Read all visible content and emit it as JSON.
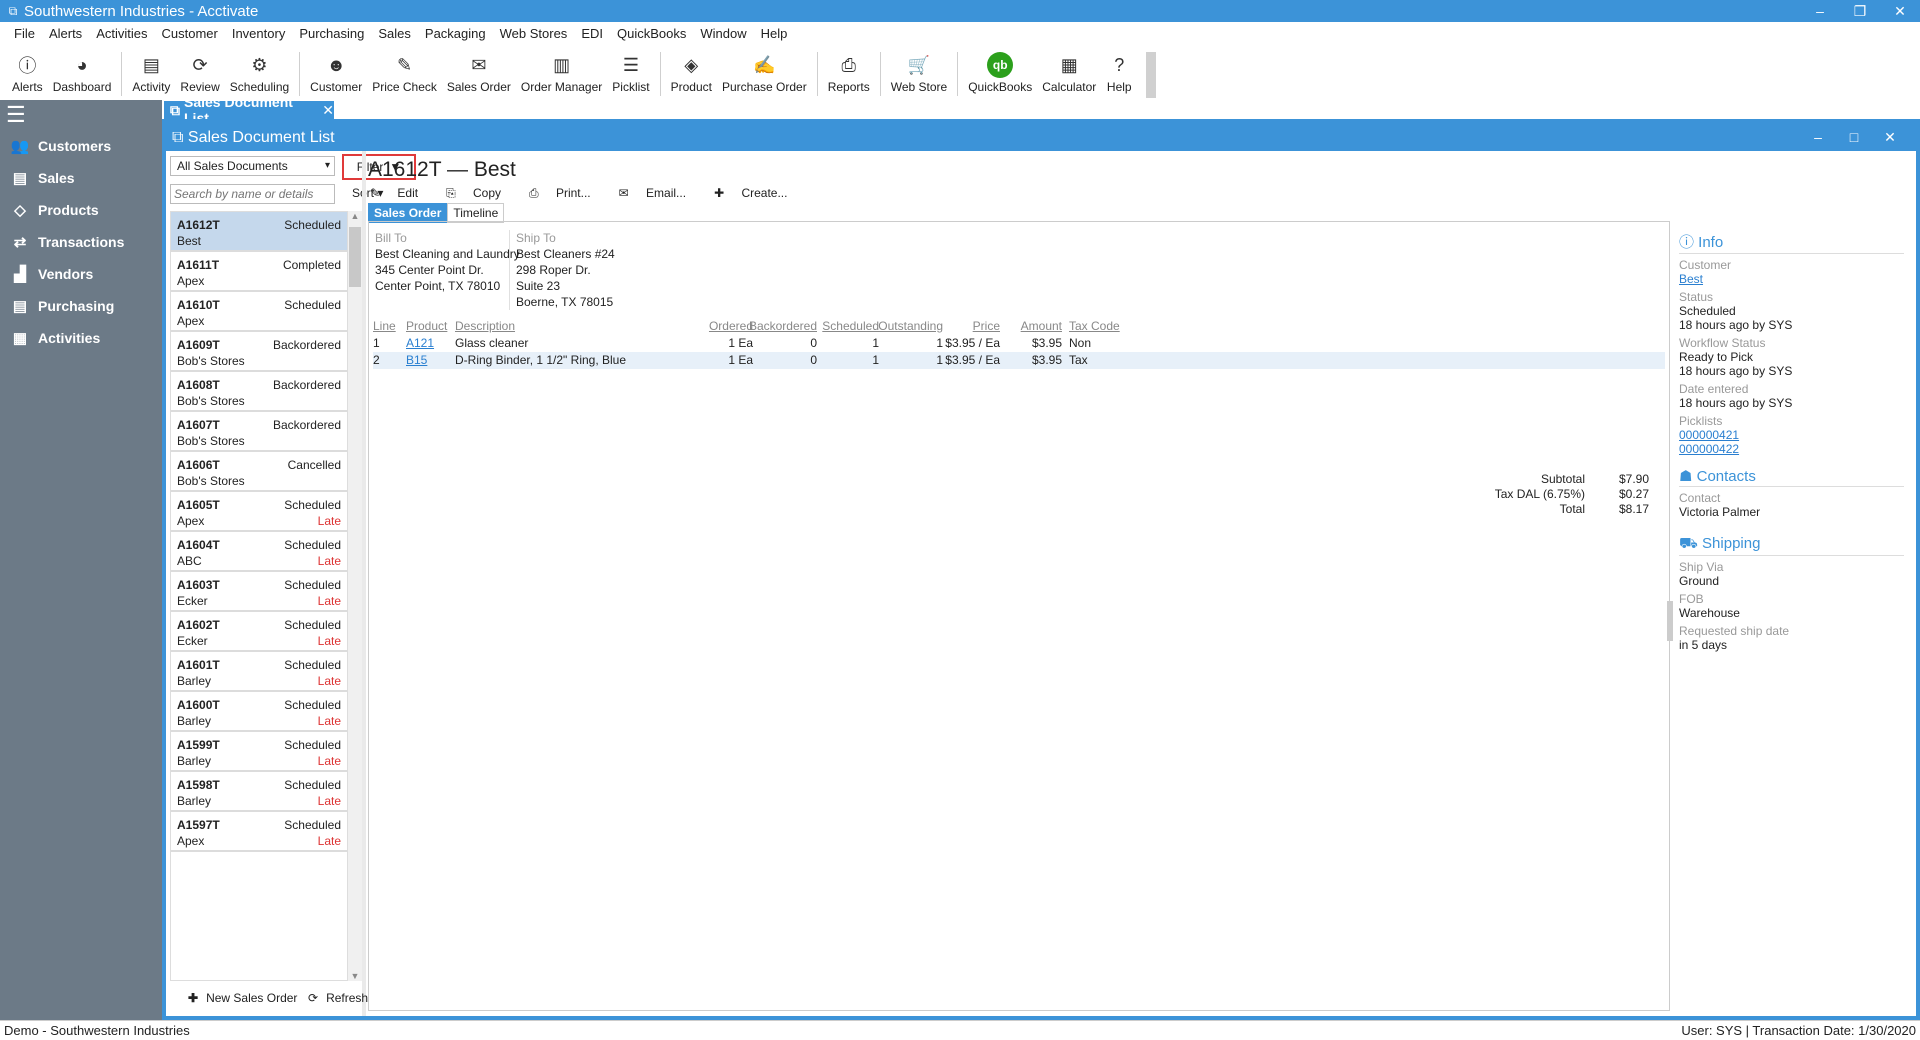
{
  "window": {
    "title": "Southwestern Industries - Acctivate",
    "controls": [
      "–",
      "❐",
      "✕"
    ]
  },
  "menu": [
    "File",
    "Alerts",
    "Activities",
    "Customer",
    "Inventory",
    "Purchasing",
    "Sales",
    "Packaging",
    "Web Stores",
    "EDI",
    "QuickBooks",
    "Window",
    "Help"
  ],
  "toolbar": [
    {
      "label": "Alerts",
      "icon": "alert-icon",
      "glyph": "ⓘ"
    },
    {
      "label": "Dashboard",
      "icon": "pie-chart-icon",
      "glyph": "◕"
    },
    {
      "sep": true
    },
    {
      "label": "Activity",
      "icon": "activity-icon",
      "glyph": "▤"
    },
    {
      "label": "Review",
      "icon": "review-icon",
      "glyph": "⟳"
    },
    {
      "label": "Scheduling",
      "icon": "scheduling-icon",
      "glyph": "⚙"
    },
    {
      "sep": true
    },
    {
      "label": "Customer",
      "icon": "customer-icon",
      "glyph": "☻"
    },
    {
      "label": "Price Check",
      "icon": "price-check-icon",
      "glyph": "✎"
    },
    {
      "label": "Sales Order",
      "icon": "sales-order-icon",
      "glyph": "✉"
    },
    {
      "label": "Order Manager",
      "icon": "order-manager-icon",
      "glyph": "▥"
    },
    {
      "label": "Picklist",
      "icon": "picklist-icon",
      "glyph": "☰"
    },
    {
      "sep": true
    },
    {
      "label": "Product",
      "icon": "product-icon",
      "glyph": "◈"
    },
    {
      "label": "Purchase Order",
      "icon": "purchase-order-icon",
      "glyph": "✍"
    },
    {
      "sep": true
    },
    {
      "label": "Reports",
      "icon": "reports-icon",
      "glyph": "⎙"
    },
    {
      "sep": true
    },
    {
      "label": "Web Store",
      "icon": "cart-icon",
      "glyph": "🛒"
    },
    {
      "sep": true
    },
    {
      "label": "QuickBooks",
      "icon": "quickbooks-icon",
      "glyph": "qb"
    },
    {
      "label": "Calculator",
      "icon": "calculator-icon",
      "glyph": "▦"
    },
    {
      "label": "Help",
      "icon": "help-icon",
      "glyph": "?"
    }
  ],
  "nav": [
    {
      "label": "Customers",
      "icon": "customers-icon",
      "glyph": "👥"
    },
    {
      "label": "Sales",
      "icon": "sales-icon",
      "glyph": "▤"
    },
    {
      "label": "Products",
      "icon": "tag-icon",
      "glyph": "◇"
    },
    {
      "label": "Transactions",
      "icon": "transactions-icon",
      "glyph": "⇄"
    },
    {
      "label": "Vendors",
      "icon": "vendors-icon",
      "glyph": "▟"
    },
    {
      "label": "Purchasing",
      "icon": "purchasing-icon",
      "glyph": "▤"
    },
    {
      "label": "Activities",
      "icon": "activities-icon",
      "glyph": "▦"
    }
  ],
  "doc_tab": {
    "label": "Sales Document List",
    "close": "✕"
  },
  "inner_window": {
    "title": "Sales Document List"
  },
  "list": {
    "filter_value": "All Sales Documents",
    "filter_button": "Filter",
    "search_placeholder": "Search by name or details",
    "sort_label": "Sort",
    "items": [
      {
        "number": "A1612T",
        "status": "Scheduled",
        "customer": "Best",
        "late": "",
        "selected": true
      },
      {
        "number": "A1611T",
        "status": "Completed",
        "customer": "Apex",
        "late": ""
      },
      {
        "number": "A1610T",
        "status": "Scheduled",
        "customer": "Apex",
        "late": ""
      },
      {
        "number": "A1609T",
        "status": "Backordered",
        "customer": "Bob's Stores",
        "late": ""
      },
      {
        "number": "A1608T",
        "status": "Backordered",
        "customer": "Bob's Stores",
        "late": ""
      },
      {
        "number": "A1607T",
        "status": "Backordered",
        "customer": "Bob's Stores",
        "late": ""
      },
      {
        "number": "A1606T",
        "status": "Cancelled",
        "customer": "Bob's Stores",
        "late": ""
      },
      {
        "number": "A1605T",
        "status": "Scheduled",
        "customer": "Apex",
        "late": "Late"
      },
      {
        "number": "A1604T",
        "status": "Scheduled",
        "customer": "ABC",
        "late": "Late"
      },
      {
        "number": "A1603T",
        "status": "Scheduled",
        "customer": "Ecker",
        "late": "Late"
      },
      {
        "number": "A1602T",
        "status": "Scheduled",
        "customer": "Ecker",
        "late": "Late"
      },
      {
        "number": "A1601T",
        "status": "Scheduled",
        "customer": "Barley",
        "late": "Late"
      },
      {
        "number": "A1600T",
        "status": "Scheduled",
        "customer": "Barley",
        "late": "Late"
      },
      {
        "number": "A1599T",
        "status": "Scheduled",
        "customer": "Barley",
        "late": "Late"
      },
      {
        "number": "A1598T",
        "status": "Scheduled",
        "customer": "Barley",
        "late": "Late"
      },
      {
        "number": "A1597T",
        "status": "Scheduled",
        "customer": "Apex",
        "late": "Late"
      }
    ],
    "new_order_label": "New Sales Order",
    "refresh_label": "Refresh"
  },
  "detail": {
    "title": "A1612T — Best",
    "actions": [
      "Edit",
      "Copy",
      "Print...",
      "Email...",
      "Create..."
    ],
    "tabs": [
      "Sales Order",
      "Timeline"
    ],
    "bill_to": {
      "label": "Bill To",
      "lines": [
        "Best Cleaning and Laundry",
        "345 Center Point Dr.",
        "Center Point, TX  78010"
      ]
    },
    "ship_to": {
      "label": "Ship To",
      "lines": [
        "Best Cleaners #24",
        "298 Roper Dr.",
        "Suite 23",
        "Boerne, TX  78015"
      ]
    },
    "columns": [
      "Line",
      "Product",
      "Description",
      "Ordered",
      "Backordered",
      "Scheduled",
      "Outstanding",
      "Price",
      "Amount",
      "Tax Code"
    ],
    "lines": [
      {
        "line": "1",
        "product": "A121",
        "description": "Glass cleaner",
        "ordered": "1 Ea",
        "backordered": "0",
        "scheduled": "1",
        "outstanding": "1",
        "price": "$3.95 / Ea",
        "amount": "$3.95",
        "tax": "Non"
      },
      {
        "line": "2",
        "product": "B15",
        "description": "D-Ring Binder, 1 1/2\" Ring, Blue",
        "ordered": "1 Ea",
        "backordered": "0",
        "scheduled": "1",
        "outstanding": "1",
        "price": "$3.95 / Ea",
        "amount": "$3.95",
        "tax": "Tax"
      }
    ],
    "totals": [
      {
        "label": "Subtotal",
        "value": "$7.90"
      },
      {
        "label": "Tax DAL (6.75%)",
        "value": "$0.27"
      },
      {
        "label": "Total",
        "value": "$8.17"
      }
    ]
  },
  "info": {
    "info_header": "Info",
    "customer_label": "Customer",
    "customer_value": "Best",
    "status_label": "Status",
    "status_value": "Scheduled",
    "status_when": "18 hours ago by SYS",
    "workflow_label": "Workflow Status",
    "workflow_value": "Ready to Pick",
    "workflow_when": "18 hours ago by SYS",
    "entered_label": "Date entered",
    "entered_when": "18 hours ago by SYS",
    "picklists_label": "Picklists",
    "picklists": [
      "000000421",
      "000000422"
    ],
    "contacts_header": "Contacts",
    "contact_label": "Contact",
    "contact_value": "Victoria Palmer",
    "shipping_header": "Shipping",
    "shipvia_label": "Ship Via",
    "shipvia_value": "Ground",
    "fob_label": "FOB",
    "fob_value": "Warehouse",
    "reqship_label": "Requested ship date",
    "reqship_value": "in 5 days"
  },
  "statusbar": {
    "left": "Demo - Southwestern Industries",
    "right": "User: SYS  |  Transaction Date: 1/30/2020"
  }
}
